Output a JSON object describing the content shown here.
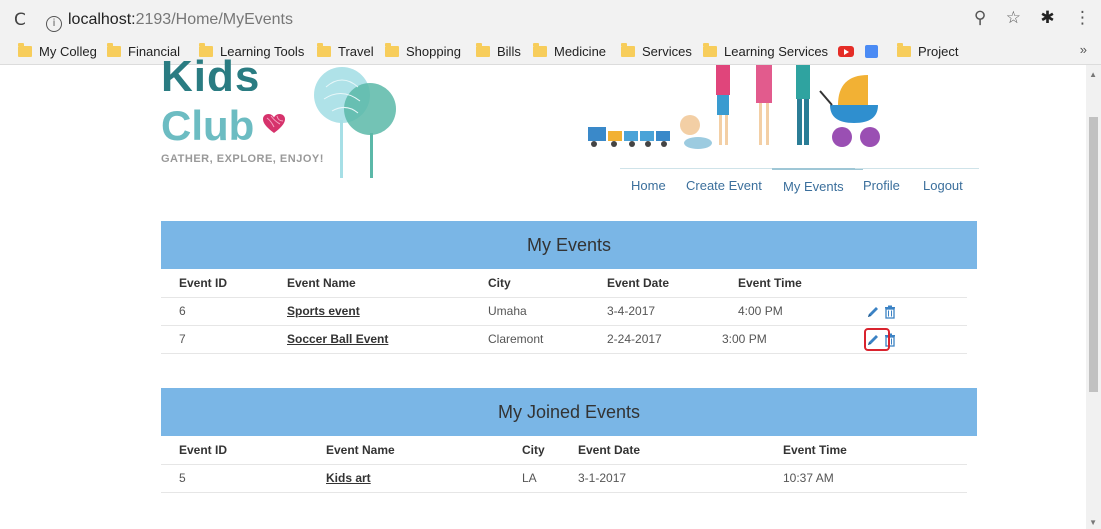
{
  "browser": {
    "reload_icon": "reload-icon",
    "url_host": "localhost:",
    "url_port_path": "2193/Home/MyEvents",
    "bookmarks": [
      {
        "label": "My Colleg",
        "icon": "folder-icon"
      },
      {
        "label": "Financial",
        "icon": "folder-icon"
      },
      {
        "label": "Learning Tools",
        "icon": "folder-icon"
      },
      {
        "label": "Travel",
        "icon": "folder-icon"
      },
      {
        "label": "Shopping",
        "icon": "folder-icon"
      },
      {
        "label": "Bills",
        "icon": "folder-icon"
      },
      {
        "label": "Medicine",
        "icon": "folder-icon"
      },
      {
        "label": "Services",
        "icon": "folder-icon"
      },
      {
        "label": "Learning Services",
        "icon": "folder-icon"
      },
      {
        "label": "Project",
        "icon": "folder-icon"
      }
    ],
    "more_bookmarks": "»"
  },
  "logo": {
    "line1": "Kids",
    "line2": "Club",
    "tagline": "GATHER, EXPLORE, ENJOY!",
    "primary_color": "#2a7c82",
    "secondary_color": "#6cbcc2",
    "heart_color": "#d6336c"
  },
  "nav": {
    "items": [
      "Home",
      "Create Event",
      "My Events",
      "Profile",
      "Logout"
    ],
    "active": "My Events"
  },
  "my_events": {
    "title": "My Events",
    "columns": [
      "Event ID",
      "Event Name",
      "City",
      "Event Date",
      "Event Time"
    ],
    "rows": [
      {
        "id": "6",
        "name": "Sports event",
        "city": "Umaha",
        "date": "3-4-2017",
        "time": "4:00 PM"
      },
      {
        "id": "7",
        "name": "Soccer Ball Event",
        "city": "Claremont",
        "date": "2-24-2017",
        "time": "3:00 PM"
      }
    ]
  },
  "joined_events": {
    "title": "My Joined Events",
    "columns": [
      "Event ID",
      "Event Name",
      "City",
      "Event Date",
      "Event Time"
    ],
    "rows": [
      {
        "id": "5",
        "name": "Kids art",
        "city": "LA",
        "date": "3-1-2017",
        "time": "10:37 AM"
      }
    ]
  },
  "colors": {
    "header_bar": "#7ab6e6",
    "nav_link": "#3b6f9c",
    "action_icon": "#3b82c4",
    "highlight": "#d9232e"
  }
}
